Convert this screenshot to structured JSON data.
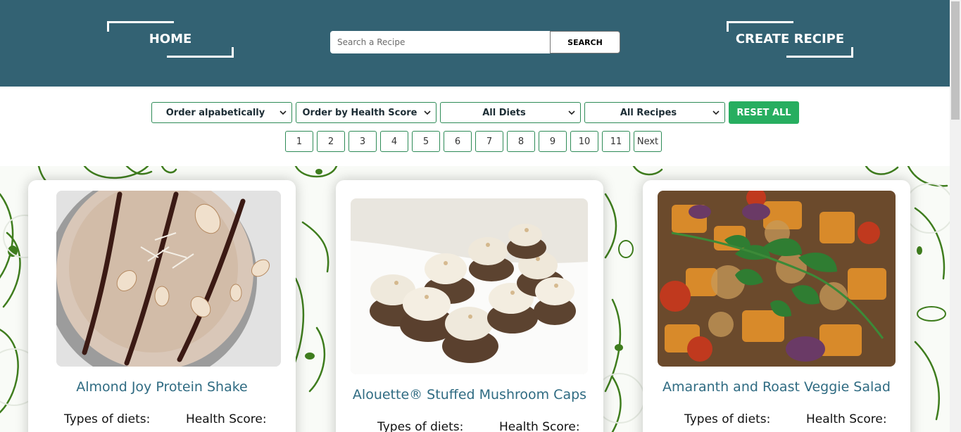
{
  "header": {
    "home_label": "HOME",
    "create_label": "CREATE RECIPE",
    "search_placeholder": "Search a Recipe",
    "search_button": "SEARCH"
  },
  "filters": {
    "order_alpha": "Order alpabetically",
    "order_health": "Order by Health Score",
    "diets": "All Diets",
    "recipes": "All Recipes",
    "reset": "RESET ALL"
  },
  "pagination": {
    "pages": [
      "1",
      "2",
      "3",
      "4",
      "5",
      "6",
      "7",
      "8",
      "9",
      "10",
      "11"
    ],
    "next": "Next"
  },
  "cards": [
    {
      "title": "Almond Joy Protein Shake",
      "diets_label": "Types of diets:",
      "health_label": "Health Score:"
    },
    {
      "title": "Alouette® Stuffed Mushroom Caps",
      "diets_label": "Types of diets:",
      "health_label": "Health Score:"
    },
    {
      "title": "Amaranth and Roast Veggie Salad",
      "diets_label": "Types of diets:",
      "health_label": "Health Score:"
    }
  ],
  "colors": {
    "header": "#336273",
    "accent_green": "#27ae60",
    "title_blue": "#2f6b82"
  }
}
